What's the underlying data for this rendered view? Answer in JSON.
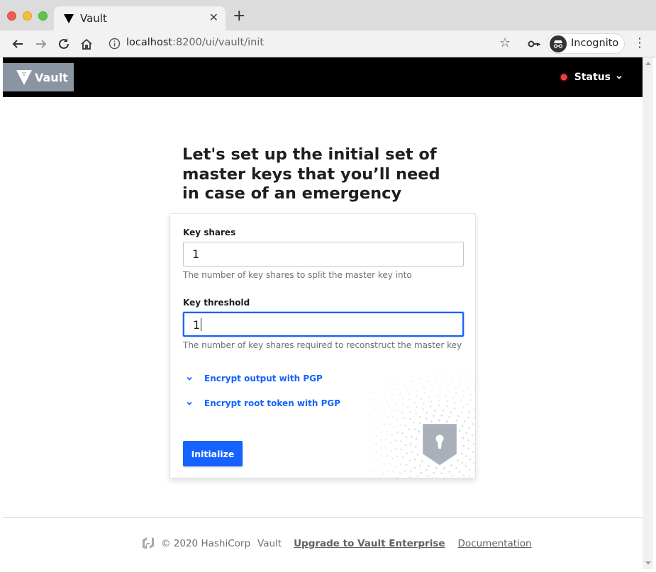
{
  "browser": {
    "tab_title": "Vault",
    "url_host": "localhost",
    "url_rest": ":8200/ui/vault/init",
    "incognito_label": "Incognito"
  },
  "header": {
    "brand": "Vault",
    "status_label": "Status",
    "status_color": "#ff2e2e"
  },
  "main": {
    "title": "Let's set up the initial set of master keys that you’ll need in case of an emergency",
    "key_shares": {
      "label": "Key shares",
      "value": "1",
      "help": "The number of key shares to split the master key into"
    },
    "key_threshold": {
      "label": "Key threshold",
      "value": "1",
      "help": "The number of key shares required to reconstruct the master key"
    },
    "pgp_output_toggle": "Encrypt output with PGP",
    "pgp_root_toggle": "Encrypt root token with PGP",
    "init_button": "Initialize",
    "accent_color": "#1563ff"
  },
  "footer": {
    "copyright": "© 2020 HashiCorp",
    "product": "Vault",
    "upgrade_link": "Upgrade to Vault Enterprise",
    "docs_link": "Documentation"
  }
}
